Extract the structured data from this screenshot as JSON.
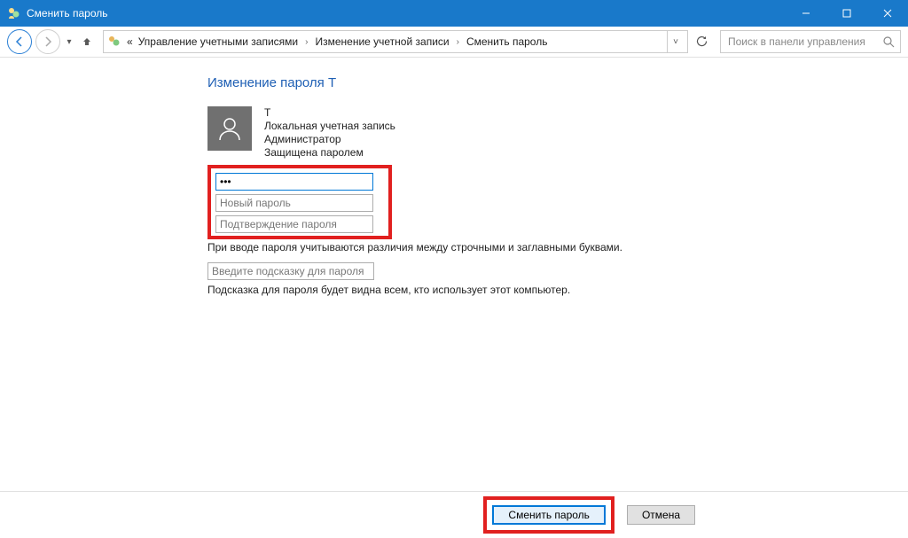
{
  "window": {
    "title": "Сменить пароль"
  },
  "breadcrumb": {
    "prefix": "«",
    "items": [
      "Управление учетными записями",
      "Изменение учетной записи",
      "Сменить пароль"
    ]
  },
  "search": {
    "placeholder": "Поиск в панели управления"
  },
  "page": {
    "heading": "Изменение пароля T"
  },
  "account": {
    "name": "T",
    "type": "Локальная учетная запись",
    "role": "Администратор",
    "protected": "Защищена паролем"
  },
  "fields": {
    "current_value": "•••",
    "new_placeholder": "Новый пароль",
    "confirm_placeholder": "Подтверждение пароля",
    "case_note": "При вводе пароля учитываются различия между строчными и заглавными буквами.",
    "hint_placeholder": "Введите подсказку для пароля",
    "hint_note": "Подсказка для пароля будет видна всем, кто использует этот компьютер."
  },
  "buttons": {
    "submit": "Сменить пароль",
    "cancel": "Отмена"
  }
}
